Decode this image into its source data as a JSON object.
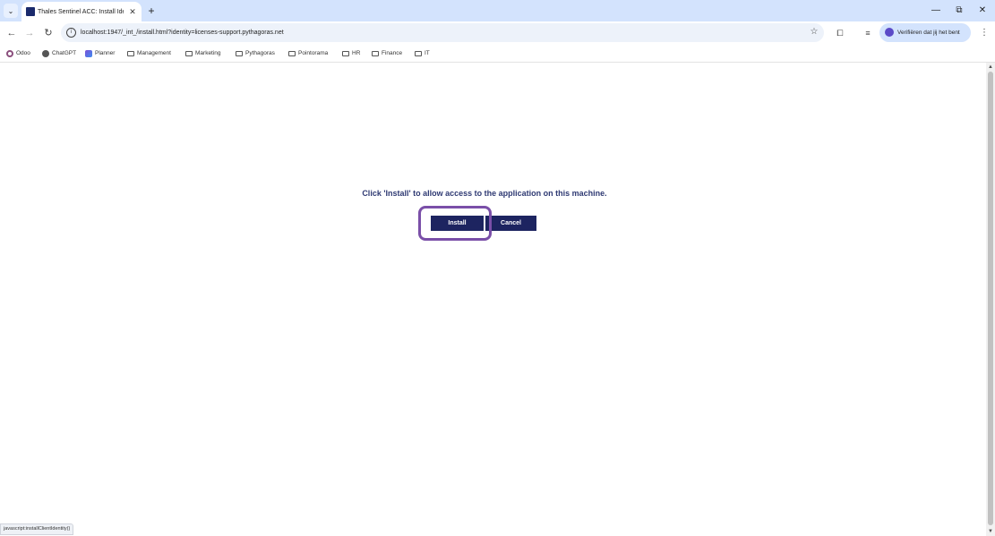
{
  "browser": {
    "tab": {
      "title": "Thales Sentinel ACC: Install Identity",
      "close_glyph": "✕"
    },
    "new_tab_glyph": "+",
    "tab_search_glyph": "⌄",
    "window_controls": {
      "minimize": "—",
      "restore": "⧉",
      "close": "✕"
    },
    "nav": {
      "back": "←",
      "forward": "→",
      "reload": "↻"
    },
    "address_bar": {
      "url": "localhost:1947/_int_/install.html?identity=licenses-support.pythagoras.net",
      "info_glyph": "i",
      "bookmark_star": "☆"
    },
    "toolbar_icons": {
      "extensions": "⧠",
      "media": "≡"
    },
    "profile": {
      "label": "Verifiëren dat jij het bent"
    },
    "menu_glyph": "⋮",
    "bookmarks": [
      {
        "label": "Odoo",
        "icon": "odoo-icon"
      },
      {
        "label": "ChatGPT",
        "icon": "chatgpt-icon"
      },
      {
        "label": "Planner",
        "icon": "planner-icon"
      },
      {
        "label": "Management",
        "icon": "folder-icon"
      },
      {
        "label": "Marketing",
        "icon": "folder-icon"
      },
      {
        "label": "Pythagoras",
        "icon": "folder-icon"
      },
      {
        "label": "Pointorama",
        "icon": "folder-icon"
      },
      {
        "label": "HR",
        "icon": "folder-icon"
      },
      {
        "label": "Finance",
        "icon": "folder-icon"
      },
      {
        "label": "IT",
        "icon": "folder-icon"
      }
    ],
    "status_text": "javascript:installClientIdentity()"
  },
  "page": {
    "message": "Click 'Install' to allow access to the application on this machine.",
    "install_label": "Install",
    "cancel_label": "Cancel"
  },
  "colors": {
    "button_bg": "#1d2460",
    "message_text": "#2f3a73",
    "highlight_ring": "#7a4fa8"
  }
}
